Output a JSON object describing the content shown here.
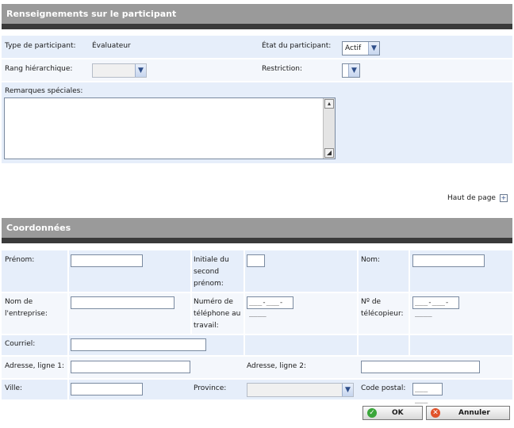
{
  "participant": {
    "header": "Renseignements sur le participant",
    "type_label": "Type de participant:",
    "type_value": "Évaluateur",
    "etat_label": "État du participant:",
    "etat_value": "Actif",
    "rang_label": "Rang hiérarchique:",
    "rang_value": "",
    "restriction_label": "Restriction:",
    "restriction_value": "",
    "remarques_label": "Remarques spéciales:",
    "remarques_value": ""
  },
  "top_link": {
    "label": "Haut de page",
    "icon": "plus-box-icon"
  },
  "contact": {
    "header": "Coordonnées",
    "prenom_label": "Prénom:",
    "initiale_label": "Initiale du second prénom:",
    "nom_label": "Nom:",
    "entreprise_label": "Nom de l'entreprise:",
    "tel_travail_label": "Numéro de téléphone au travail:",
    "tel_travail_mask": "___-___-____",
    "telecopieur_label": "Nº de télécopieur:",
    "telecopieur_mask": "___-___-____",
    "courriel_label": "Courriel:",
    "adresse1_label": "Adresse, ligne 1:",
    "adresse2_label": "Adresse, ligne 2:",
    "ville_label": "Ville:",
    "province_label": "Province:",
    "province_value": "",
    "code_postal_label": "Code postal:",
    "code_postal_mask": "___ ___"
  },
  "buttons": {
    "ok": "OK",
    "annuler": "Annuler"
  },
  "colors": {
    "header_bg": "#9a9a9a",
    "header_bar": "#3a3a3a",
    "band": "#e6eefa",
    "ok_icon": "#3aa63a",
    "cancel_icon": "#e0522a"
  }
}
